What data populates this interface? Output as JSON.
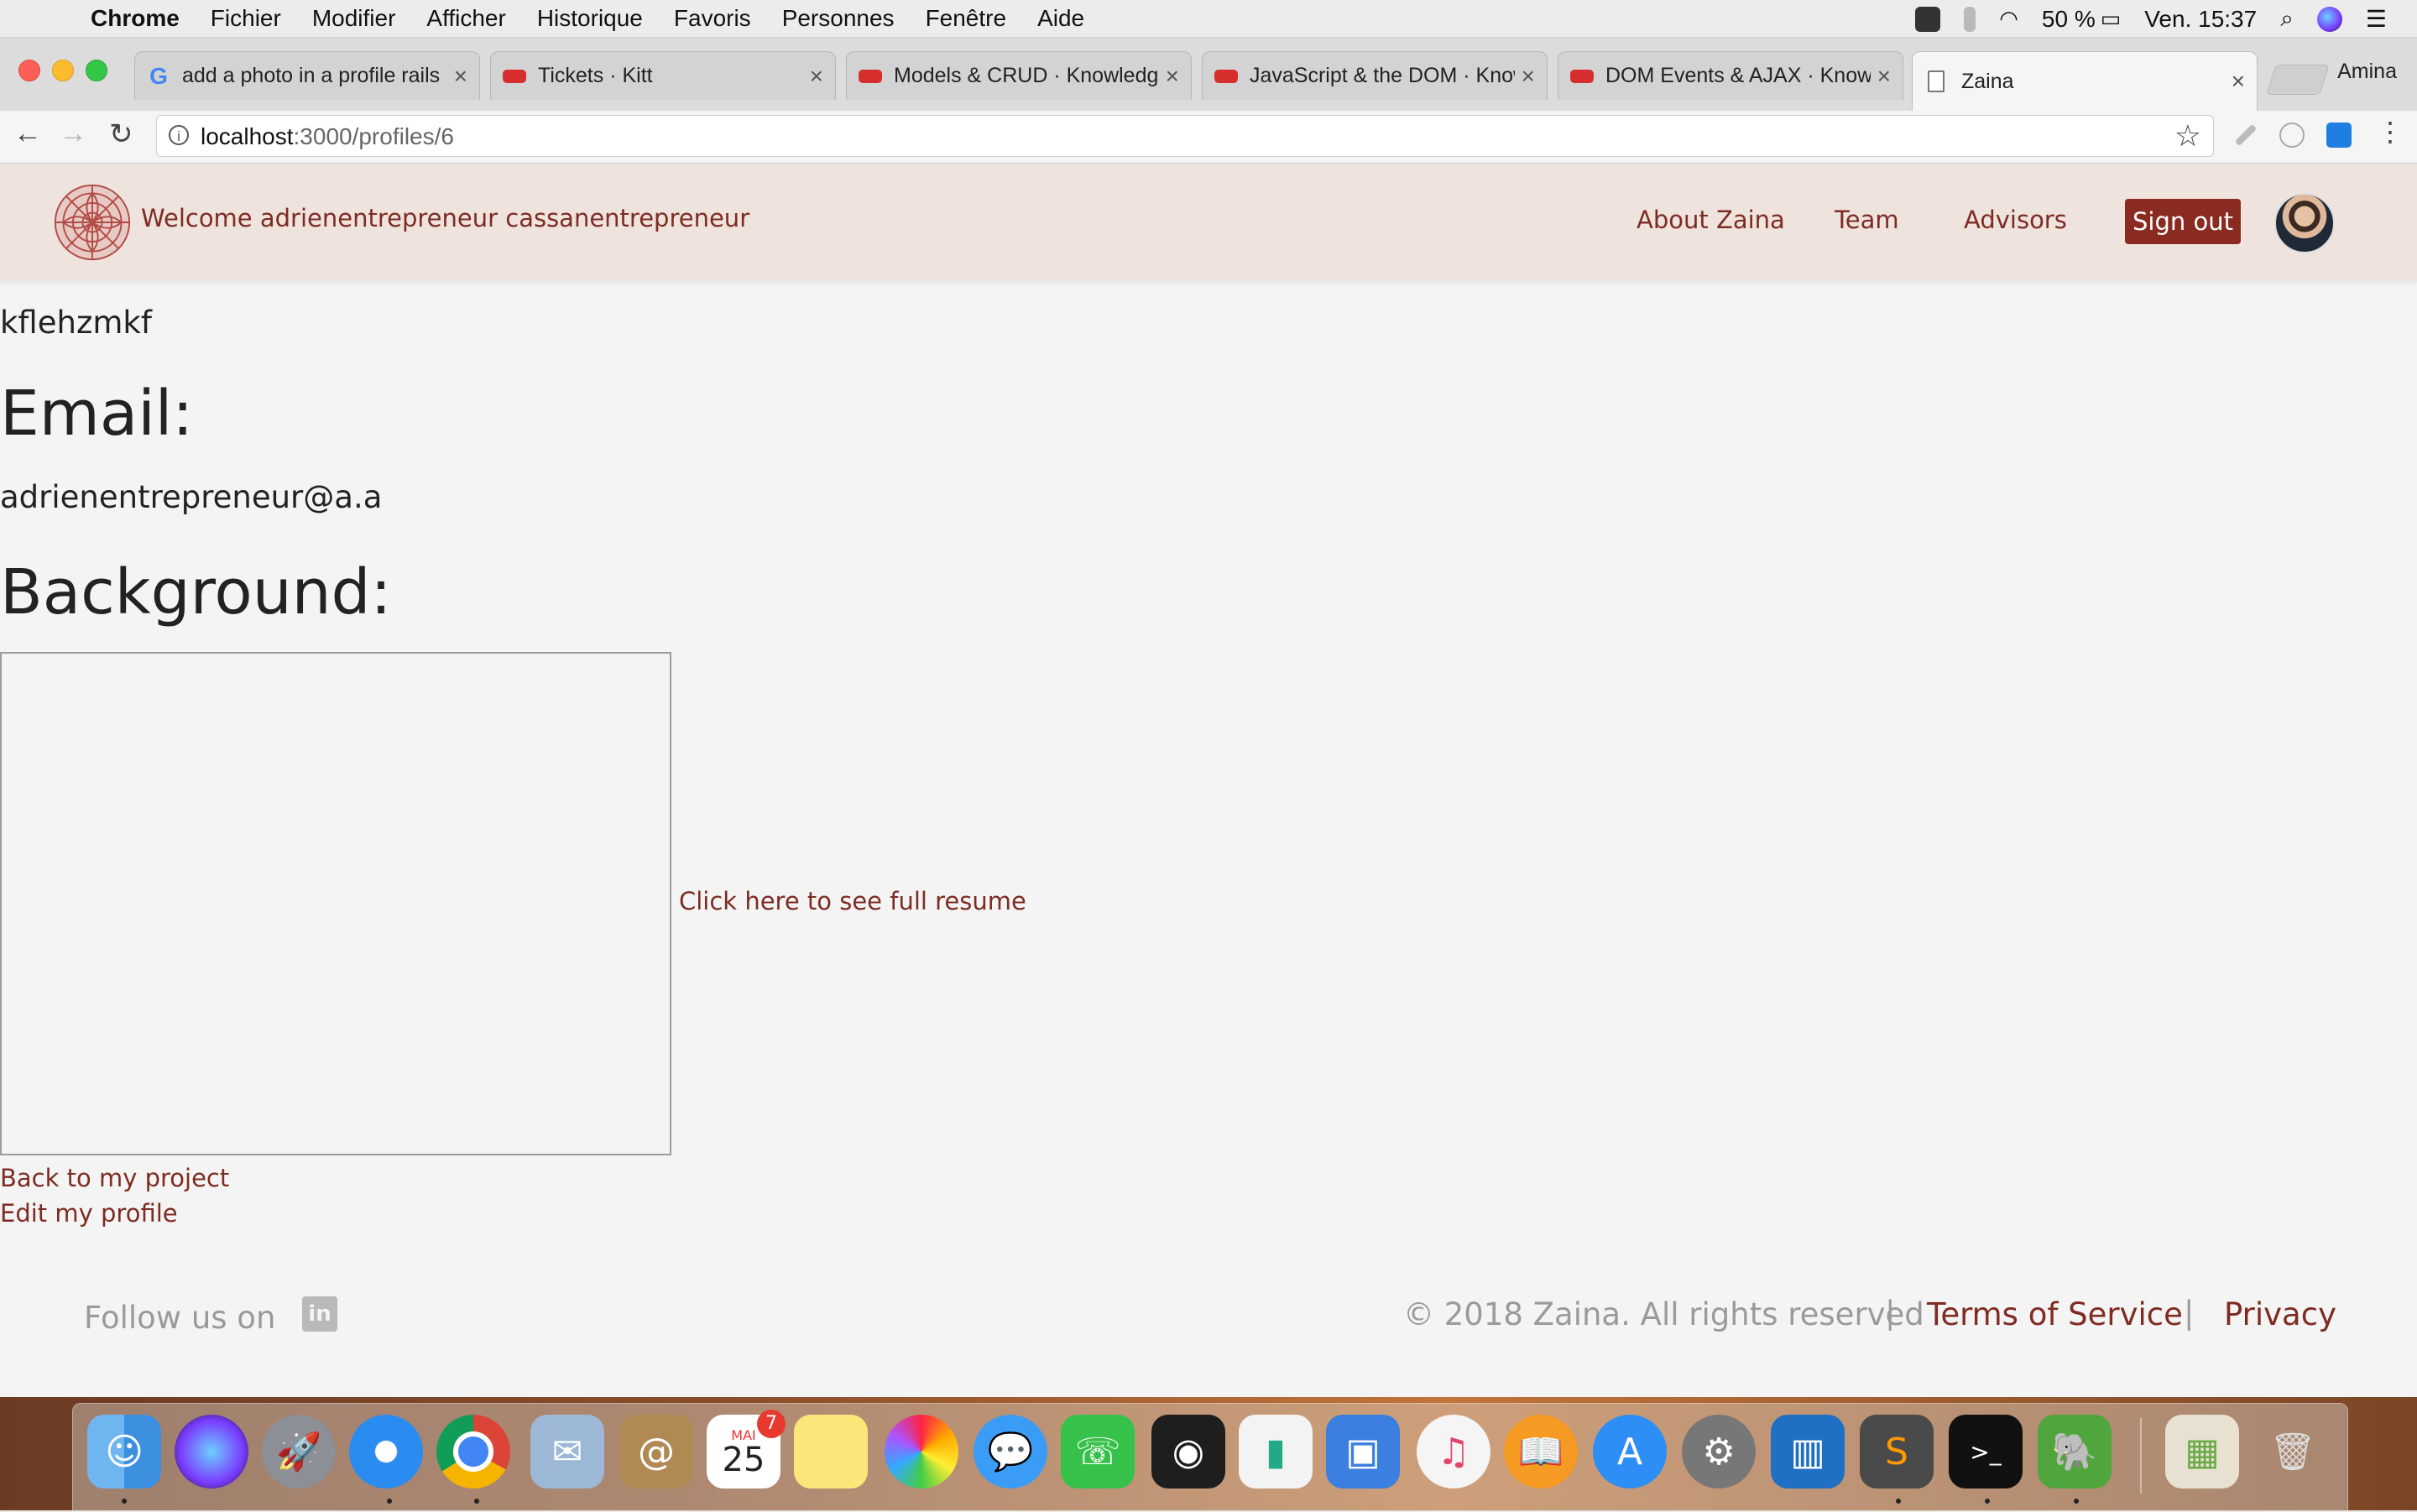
{
  "menubar": {
    "app_name": "Chrome",
    "menus": [
      "Fichier",
      "Modifier",
      "Afficher",
      "Historique",
      "Favoris",
      "Personnes",
      "Fenêtre",
      "Aide"
    ],
    "battery": "50 %",
    "clock": "Ven. 15:37"
  },
  "browser": {
    "tabs": [
      {
        "title": "add a photo in a profile rails",
        "favicon": "google-icon"
      },
      {
        "title": "Tickets · Kitt",
        "favicon": "kitt-bus-icon"
      },
      {
        "title": "Models & CRUD · Knowledge",
        "favicon": "kitt-bus-icon"
      },
      {
        "title": "JavaScript & the DOM · Knowledge",
        "favicon": "kitt-bus-icon"
      },
      {
        "title": "DOM Events & AJAX · Knowledge",
        "favicon": "kitt-bus-icon"
      },
      {
        "title": "Zaina",
        "favicon": "document-icon",
        "active": true
      }
    ],
    "profile_name": "Amina",
    "url_host": "localhost",
    "url_rest": ":3000/profiles/6"
  },
  "site": {
    "welcome": "Welcome adrienentrepreneur cassanentrepreneur",
    "nav": {
      "about": "About Zaina",
      "team": "Team",
      "advisors": "Advisors",
      "sign_out": "Sign out"
    },
    "brand_color": "#7e2c22",
    "nav_background": "#efe3de"
  },
  "profile": {
    "name": "kflehzmkf",
    "email_heading": "Email:",
    "email": "adrienentrepreneur@a.a",
    "background_heading": "Background:",
    "resume_link": "Click here to see full resume",
    "back_link": "Back to my project",
    "edit_link": "Edit my profile"
  },
  "footer": {
    "follow": "Follow us on",
    "social": "linkedin-icon",
    "copyright": "© 2018 Zaina. All rights reserved",
    "separator": "|",
    "terms": "Terms of Service",
    "privacy": "Privacy"
  },
  "dock": {
    "calendar_month": "MAI",
    "calendar_day": "25",
    "calendar_badge": "7"
  }
}
